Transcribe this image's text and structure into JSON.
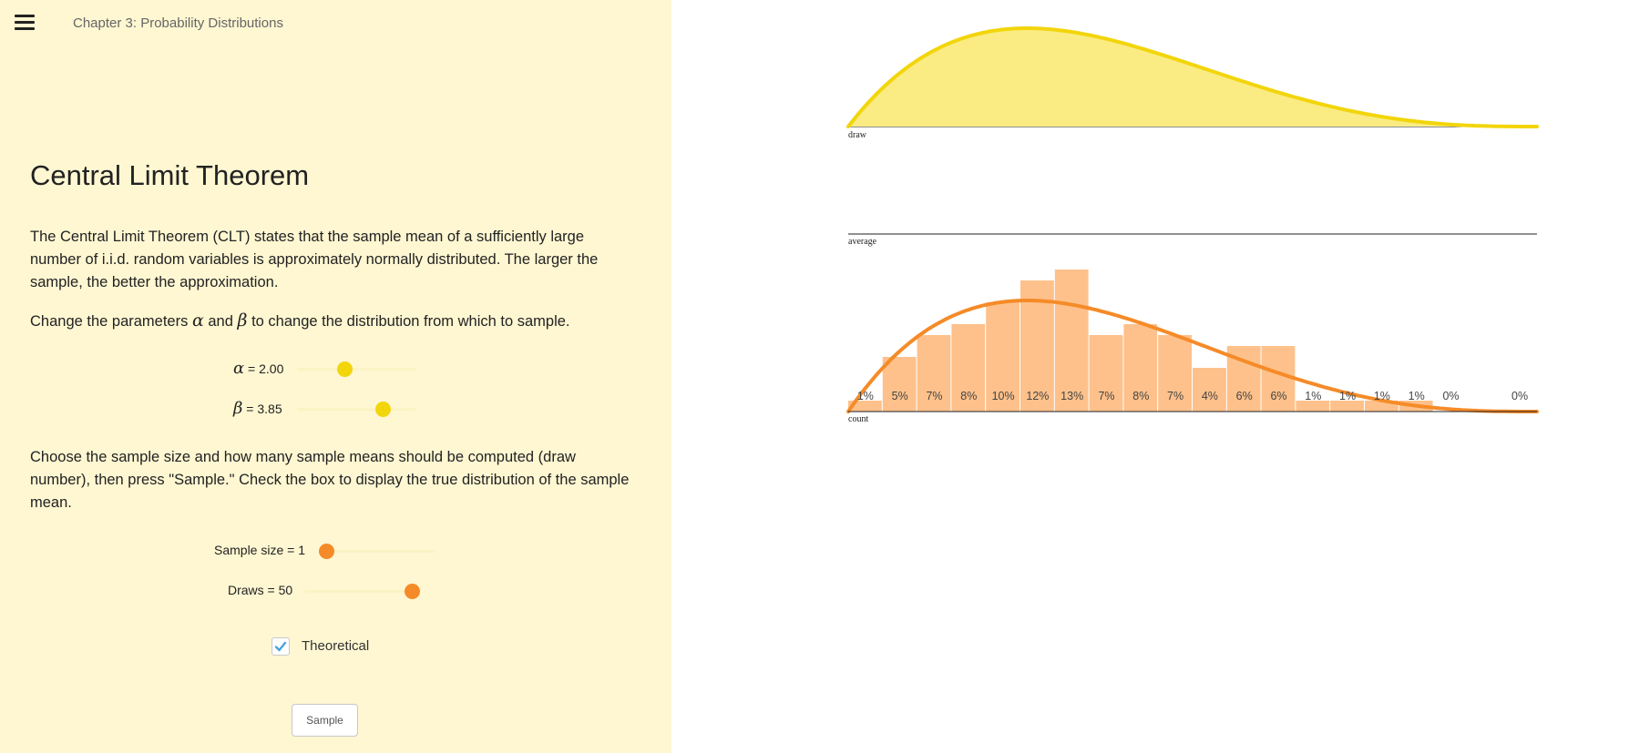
{
  "header": {
    "chapter_title": "Chapter 3: Probability Distributions"
  },
  "content": {
    "title": "Central Limit Theorem",
    "intro": "The Central Limit Theorem (CLT) states that the sample mean of a sufficiently large number of i.i.d. random variables is approximately normally distributed. The larger the sample, the better the approximation.",
    "params_text_before": "Change the parameters ",
    "alpha_symbol": "α",
    "params_text_and": " and ",
    "beta_symbol": "β",
    "params_text_after": " to change the distribution from which to sample.",
    "instructions": "Choose the sample size and how many sample means should be computed (draw number), then press \"Sample.\" Check the box to display the true distribution of the sample mean."
  },
  "controls": {
    "alpha": {
      "label_suffix": " = 2.00",
      "value": 2.0,
      "fraction": 0.4
    },
    "beta": {
      "label_suffix": " = 3.85",
      "value": 3.85,
      "fraction": 0.72
    },
    "sample_size": {
      "label": "Sample size = 1",
      "value": 1,
      "fraction": 0.0
    },
    "draws": {
      "label": "Draws = 50",
      "value": 50,
      "fraction": 1.0
    },
    "theoretical": {
      "label": "Theoretical",
      "checked": true
    },
    "sample_button": {
      "label": "Sample"
    }
  },
  "colors": {
    "panel_bg": "#fef7d2",
    "density_fill": "#faec82",
    "density_line": "#f2d50b",
    "bar_fill": "#fec18b",
    "curve": "#f58b28",
    "thumb_yellow": "#f2d50b",
    "thumb_orange": "#f58b28",
    "check": "#4aa3df"
  },
  "chart_data": [
    {
      "type": "area",
      "description_label": "draw",
      "distribution": "beta",
      "alpha": 2.0,
      "beta": 3.85,
      "xlim": [
        0,
        1
      ],
      "axis_label": "draw"
    },
    {
      "type": "line",
      "axis_label": "average",
      "points": []
    },
    {
      "type": "bar",
      "axis_label": "count",
      "xlim": [
        0,
        1
      ],
      "bins": 20,
      "labels": [
        "1%",
        "5%",
        "7%",
        "8%",
        "10%",
        "12%",
        "13%",
        "7%",
        "8%",
        "7%",
        "4%",
        "6%",
        "6%",
        "1%",
        "1%",
        "1%",
        "1%",
        "0%",
        "",
        "0%"
      ],
      "values": [
        1,
        5,
        7,
        8,
        10,
        12,
        13,
        7,
        8,
        7,
        4,
        6,
        6,
        1,
        1,
        1,
        1,
        0,
        0,
        0
      ],
      "theoretical_curve": {
        "distribution": "beta",
        "alpha": 2.0,
        "beta": 3.85
      }
    }
  ]
}
